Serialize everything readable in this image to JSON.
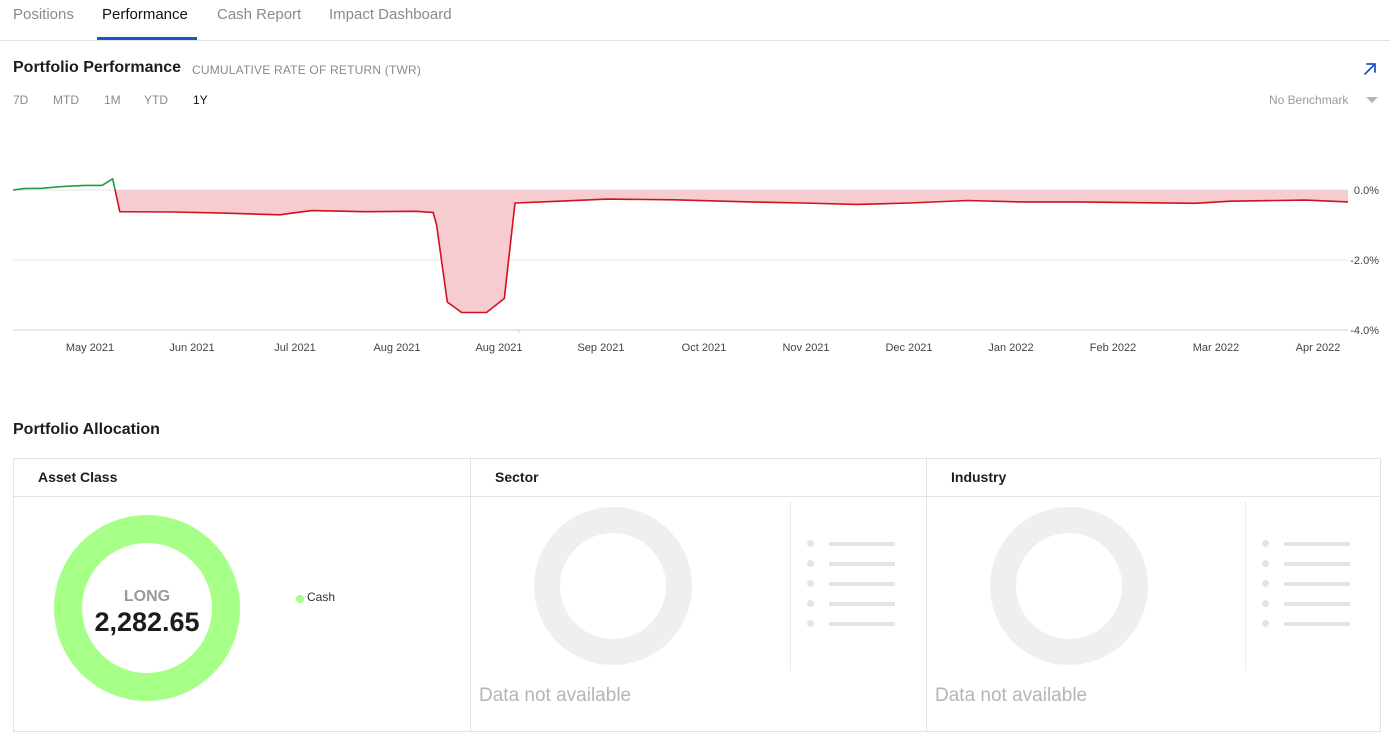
{
  "tabs": [
    {
      "label": "Positions",
      "active": false
    },
    {
      "label": "Performance",
      "active": true
    },
    {
      "label": "Cash Report",
      "active": false
    },
    {
      "label": "Impact Dashboard",
      "active": false
    }
  ],
  "performance": {
    "title": "Portfolio Performance",
    "subtitle": "CUMULATIVE RATE OF RETURN (TWR)",
    "expand_icon": "arrow-up-right-icon",
    "ranges": [
      {
        "label": "7D",
        "active": false
      },
      {
        "label": "MTD",
        "active": false
      },
      {
        "label": "1M",
        "active": false
      },
      {
        "label": "YTD",
        "active": false
      },
      {
        "label": "1Y",
        "active": true
      }
    ],
    "benchmark": "No Benchmark"
  },
  "chart_data": {
    "type": "area",
    "title": "",
    "xlabel": "",
    "ylabel": "",
    "x_ticks": [
      "May 2021",
      "Jun 2021",
      "Jul 2021",
      "Aug 2021",
      "Aug 2021",
      "Sep 2021",
      "Oct 2021",
      "Nov 2021",
      "Dec 2021",
      "Jan 2022",
      "Feb 2022",
      "Mar 2022",
      "Apr 2022"
    ],
    "y_ticks": [
      "0.0%",
      "-2.0%",
      "-4.0%"
    ],
    "ylim": [
      -4.0,
      0.5
    ],
    "grid": true,
    "colors": {
      "positive": "#1f9a3e",
      "negative": "#d0121f",
      "negative_fill": "#f7ccd1"
    },
    "series": [
      {
        "points": [
          {
            "x": "2021-04-17",
            "y": 0.0
          },
          {
            "x": "2021-04-20",
            "y": 0.04
          },
          {
            "x": "2021-04-25",
            "y": 0.05
          },
          {
            "x": "2021-05-01",
            "y": 0.1
          },
          {
            "x": "2021-05-07",
            "y": 0.13
          },
          {
            "x": "2021-05-12",
            "y": 0.13
          },
          {
            "x": "2021-05-15",
            "y": 0.32
          },
          {
            "x": "2021-05-17",
            "y": -0.62
          },
          {
            "x": "2021-06-01",
            "y": -0.63
          },
          {
            "x": "2021-06-15",
            "y": -0.66
          },
          {
            "x": "2021-07-01",
            "y": -0.71
          },
          {
            "x": "2021-07-05",
            "y": -0.65
          },
          {
            "x": "2021-07-10",
            "y": -0.59
          },
          {
            "x": "2021-07-25",
            "y": -0.62
          },
          {
            "x": "2021-08-08",
            "y": -0.61
          },
          {
            "x": "2021-08-13",
            "y": -0.64
          },
          {
            "x": "2021-08-14",
            "y": -1.0
          },
          {
            "x": "2021-08-17",
            "y": -3.2
          },
          {
            "x": "2021-08-21",
            "y": -3.5
          },
          {
            "x": "2021-08-28",
            "y": -3.5
          },
          {
            "x": "2021-09-02",
            "y": -3.1
          },
          {
            "x": "2021-09-05",
            "y": -0.37
          },
          {
            "x": "2021-09-15",
            "y": -0.33
          },
          {
            "x": "2021-10-01",
            "y": -0.26
          },
          {
            "x": "2021-10-20",
            "y": -0.28
          },
          {
            "x": "2021-11-10",
            "y": -0.34
          },
          {
            "x": "2021-11-25",
            "y": -0.37
          },
          {
            "x": "2021-12-10",
            "y": -0.41
          },
          {
            "x": "2021-12-25",
            "y": -0.37
          },
          {
            "x": "2022-01-10",
            "y": -0.3
          },
          {
            "x": "2022-01-25",
            "y": -0.34
          },
          {
            "x": "2022-02-10",
            "y": -0.34
          },
          {
            "x": "2022-02-25",
            "y": -0.36
          },
          {
            "x": "2022-03-15",
            "y": -0.38
          },
          {
            "x": "2022-03-25",
            "y": -0.32
          },
          {
            "x": "2022-04-15",
            "y": -0.29
          },
          {
            "x": "2022-04-27",
            "y": -0.34
          }
        ]
      }
    ]
  },
  "allocation": {
    "title": "Portfolio Allocation",
    "panels": [
      {
        "title": "Asset Class",
        "center_label": "LONG",
        "center_value": "2,282.65",
        "legend": [
          {
            "label": "Cash",
            "color": "#a6ff86"
          }
        ]
      },
      {
        "title": "Sector",
        "empty_text": "Data not available"
      },
      {
        "title": "Industry",
        "empty_text": "Data not available"
      }
    ]
  }
}
